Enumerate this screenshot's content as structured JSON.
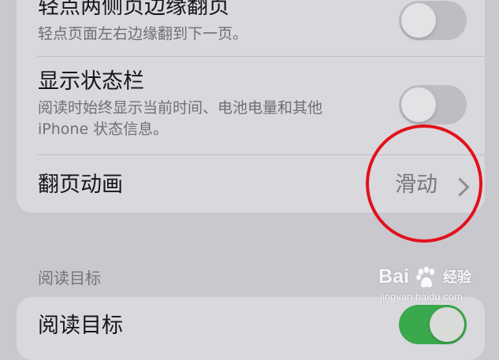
{
  "settings": {
    "rows": [
      {
        "title": "轻点两侧页边缘翻页",
        "subtitle": "轻点页面左右边缘翻到下一页。",
        "toggle": false
      },
      {
        "title": "显示状态栏",
        "subtitle": "阅读时始终显示当前时间、电池电量和其他 iPhone 状态信息。",
        "toggle": false
      },
      {
        "title": "翻页动画",
        "value": "滑动"
      }
    ]
  },
  "reading_goal_section": {
    "header": "阅读目标",
    "rows": [
      {
        "title": "阅读目标",
        "toggle": true
      }
    ]
  },
  "annotation": {
    "circle_color": "#e2101a"
  },
  "watermark": {
    "brand": "Bai",
    "brand_suffix": "经验",
    "url": "jingyan.baidu.com"
  },
  "colors": {
    "background": "#c9c8ce",
    "card": "#d9d8dd",
    "toggle_on": "#3aa84c",
    "toggle_off": "#bebdc3"
  }
}
